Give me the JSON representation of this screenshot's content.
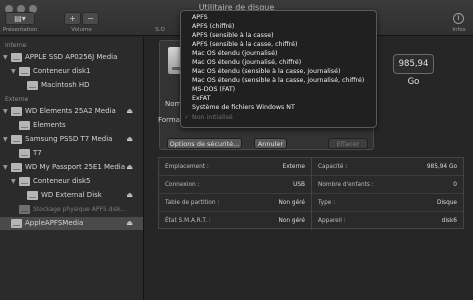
{
  "window": {
    "title": "Utilitaire de disque"
  },
  "toolbar": {
    "presentation_label": "Présentation",
    "volume_label": "Volume",
    "volume_add": "+",
    "volume_remove": "−",
    "sos_label": "S.O",
    "info_label": "Infos",
    "info_glyph": "i"
  },
  "sidebar": {
    "section_internal": "Interne",
    "section_external": "Externe",
    "items": [
      {
        "label": "APPLE SSD AP0256J Media",
        "eject": ""
      },
      {
        "label": "Conteneur disk1",
        "eject": ""
      },
      {
        "label": "Macintosh HD",
        "eject": ""
      },
      {
        "label": "WD Elements 25A2 Media",
        "eject": "⏏"
      },
      {
        "label": "Elements",
        "eject": ""
      },
      {
        "label": "Samsung PSSD T7 Media",
        "eject": "⏏"
      },
      {
        "label": "T7",
        "eject": ""
      },
      {
        "label": "WD My Passport 25E1 Media",
        "eject": "⏏"
      },
      {
        "label": "Conteneur disk5",
        "eject": ""
      },
      {
        "label": "WD External Disk",
        "eject": "⏏"
      },
      {
        "label": "Stockage physique APFS disk…",
        "eject": ""
      },
      {
        "label": "AppleAPFSMedia",
        "eject": "⏏"
      }
    ]
  },
  "main": {
    "capacity_badge": "985,94 Go"
  },
  "sheet": {
    "name_label": "Nom",
    "format_label": "Format",
    "name_partial": "E",
    "desc_partial": [
      "U",
      "in",
      "E"
    ],
    "security_button": "Options de sécurité...",
    "cancel_button": "Annuler",
    "erase_button": "Effacer"
  },
  "format_menu": {
    "options": [
      "APFS",
      "APFS (chiffré)",
      "APFS (sensible à la casse)",
      "APFS (sensible à la casse, chiffré)",
      "Mac OS étendu (journalisé)",
      "Mac OS étendu (journalisé, chiffré)",
      "Mac OS étendu (sensible à la casse, journalisé)",
      "Mac OS étendu (sensible à la casse, journalisé, chiffré)",
      "MS-DOS (FAT)",
      "ExFAT",
      "Système de fichiers Windows NT",
      "Non initialisé"
    ],
    "checkmark": "✓"
  },
  "info": {
    "left": [
      {
        "key": "Emplacement :",
        "value": "Externe"
      },
      {
        "key": "Connexion :",
        "value": "USB"
      },
      {
        "key": "Table de partition :",
        "value": "Non géré"
      },
      {
        "key": "État S.M.A.R.T. :",
        "value": "Non géré"
      }
    ],
    "right": [
      {
        "key": "Capacité :",
        "value": "985,94 Go"
      },
      {
        "key": "Nombre d'enfants :",
        "value": "0"
      },
      {
        "key": "Type :",
        "value": "Disque"
      },
      {
        "key": "Appareil :",
        "value": "disk6"
      }
    ]
  }
}
